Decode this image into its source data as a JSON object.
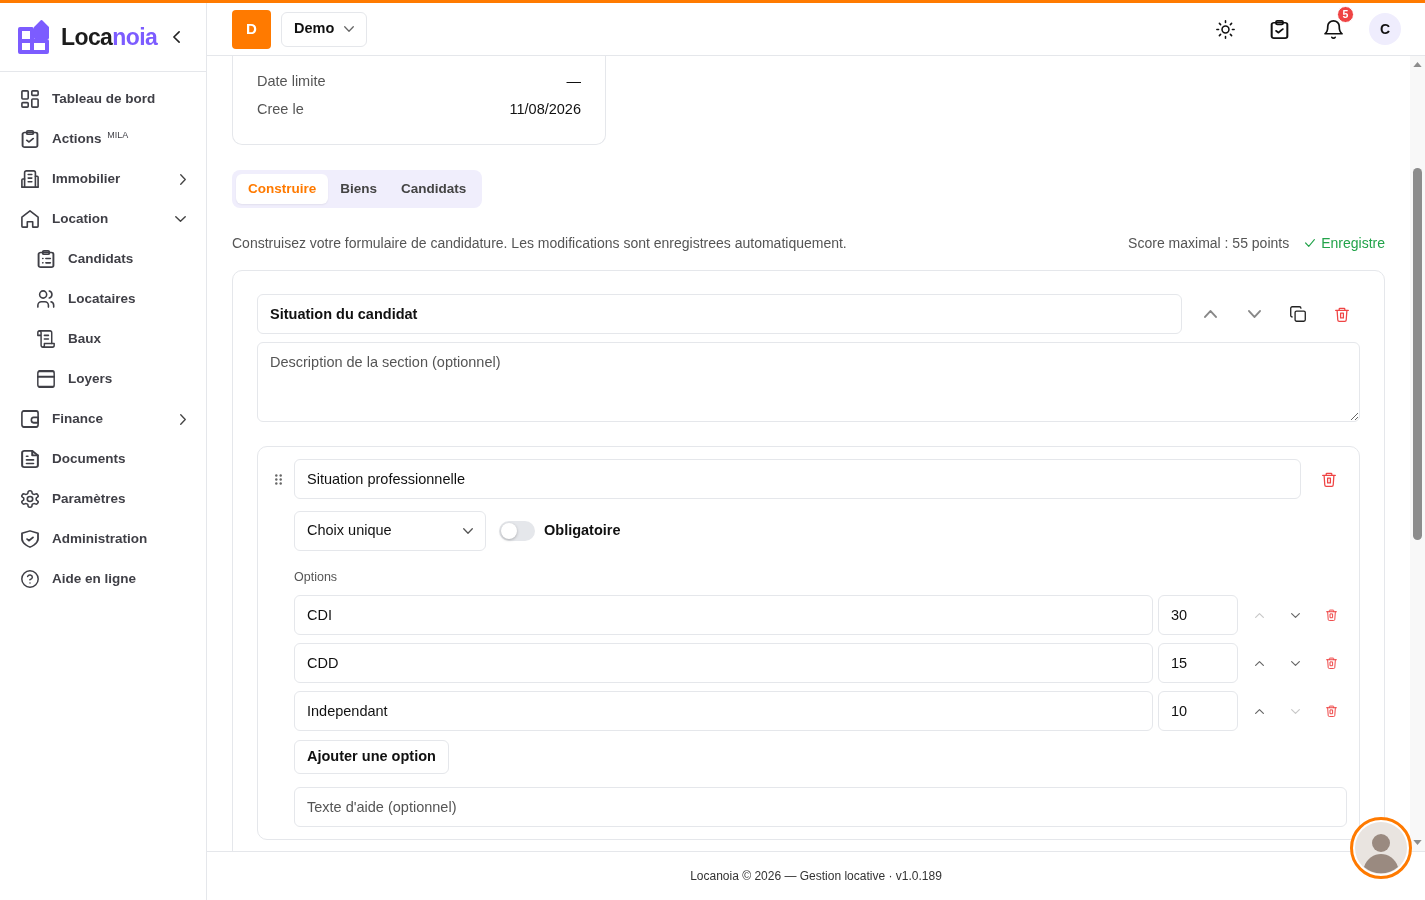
{
  "sidebar": {
    "logo": {
      "name_parts": [
        "Loca",
        "noia"
      ]
    },
    "items": [
      {
        "kind": "link",
        "label": "Tableau de bord"
      },
      {
        "kind": "link",
        "label": "Actions $^{MILA}$"
      },
      {
        "kind": "group",
        "label": "Immobilier",
        "expanded": false
      },
      {
        "kind": "group",
        "label": "Location",
        "expanded": true,
        "children": [
          {
            "label": "Candidats"
          },
          {
            "label": "Locataires"
          },
          {
            "label": "Baux"
          },
          {
            "label": "Loyers"
          }
        ]
      },
      {
        "kind": "group",
        "label": "Finance",
        "expanded": false
      },
      {
        "kind": "link",
        "label": "Documents"
      },
      {
        "kind": "link",
        "label": "Paramètres"
      },
      {
        "kind": "link",
        "label": "Administration"
      },
      {
        "kind": "link",
        "label": "Aide en ligne"
      }
    ]
  },
  "header": {
    "org_initial": "D",
    "workspace": "Demo",
    "notification_count": "5",
    "user_initial": "C"
  },
  "info_card": {
    "rows": [
      {
        "label": "Date limite",
        "value": "—"
      },
      {
        "label": "Cree le",
        "value": "11/08/2026"
      }
    ]
  },
  "tabs": [
    {
      "label": "Construire",
      "selected": true
    },
    {
      "label": "Biens",
      "selected": false
    },
    {
      "label": "Candidats",
      "selected": false
    }
  ],
  "intro": "Construisez votre formulaire de candidature. Les modifications sont enregistrees automatiquement.",
  "max_score": "Score maximal : 55 points",
  "save_status": "Enregistre",
  "section": {
    "title": "Situation du candidat",
    "description": {
      "placeholder": "Description de la section (optionnel)"
    },
    "questions": [
      {
        "title": "Situation professionnelle",
        "type": "Choix unique",
        "required": false,
        "required_label": "Obligatoire",
        "options_label": "Options",
        "options": [
          {
            "label": "CDI",
            "score": "30",
            "move_up_disabled": true,
            "move_down_disabled": false
          },
          {
            "label": "CDD",
            "score": "15",
            "move_up_disabled": false,
            "move_down_disabled": false
          },
          {
            "label": "Independant",
            "score": "10",
            "move_up_disabled": false,
            "move_down_disabled": true
          }
        ],
        "add_option_button": "Ajouter une option",
        "help": {
          "placeholder": "Texte d'aide (optionnel)"
        }
      }
    ]
  },
  "footer": "Locanoia © 2026 — Gestion locative · v1.0.189"
}
